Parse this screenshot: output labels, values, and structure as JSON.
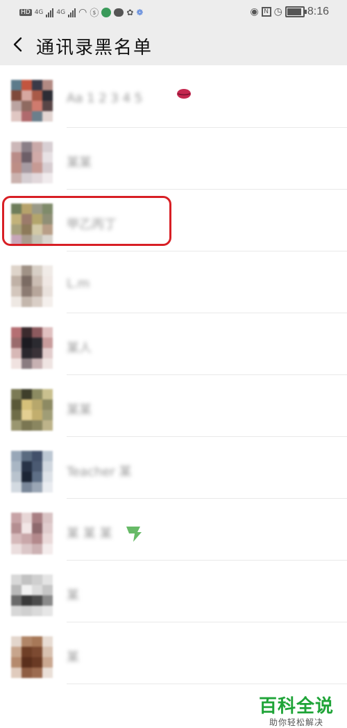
{
  "status_bar": {
    "left_label": "HD",
    "network_1": "4G",
    "network_2": "4G",
    "time": "8:16"
  },
  "header": {
    "title": "通讯录黑名单"
  },
  "contacts": [
    {
      "name": "Aa 1 2 3 4 5",
      "avatar_colors": [
        "#5c7b8b",
        "#c2553f",
        "#3a3a48",
        "#b28a83",
        "#7f4a3b",
        "#d6a7a0",
        "#a95a48",
        "#2d2d35",
        "#bba4a1",
        "#8f6a60",
        "#cf7b6e",
        "#594647",
        "#e0c7c3",
        "#b06a6d",
        "#6b7f8c",
        "#e3d5d2"
      ]
    },
    {
      "name": "某某",
      "avatar_colors": [
        "#ccb7b8",
        "#8a7f87",
        "#c9a9a8",
        "#d8cfd3",
        "#b98c88",
        "#6d5f68",
        "#d0aaa8",
        "#e7e1e4",
        "#bd8e86",
        "#a79ba2",
        "#c69a94",
        "#d7cdd1",
        "#cbb2ae",
        "#d6cfd3",
        "#e2d8db",
        "#f0ebed"
      ]
    },
    {
      "name": "甲乙丙丁",
      "avatar_colors": [
        "#6e7d5a",
        "#b6a26b",
        "#9a9a87",
        "#7f8b6a",
        "#c2b27a",
        "#9b7b6b",
        "#b3a56c",
        "#8f8f76",
        "#a7a17b",
        "#8d7a5a",
        "#d2c9a6",
        "#b89e87",
        "#c7a6b8",
        "#a99b8d",
        "#c2c0b3",
        "#d9d5ce"
      ]
    },
    {
      "name": "L.m",
      "avatar_colors": [
        "#ded4ca",
        "#a09286",
        "#d7cfc6",
        "#f0ebe7",
        "#c0b1a6",
        "#7b6b63",
        "#cbbdb3",
        "#efe7e3",
        "#d3c6bc",
        "#8c7b72",
        "#b7a69b",
        "#e9e1dc",
        "#eee8e3",
        "#c4b7ad",
        "#d9cec6",
        "#f4efec"
      ]
    },
    {
      "name": "某人",
      "avatar_colors": [
        "#b56f73",
        "#3b2a2d",
        "#8c5a5e",
        "#e0c0c0",
        "#9a6b6c",
        "#1c1b21",
        "#2b2a30",
        "#c89c9c",
        "#d7b8b6",
        "#2a272d",
        "#3a3238",
        "#e2cccc",
        "#f0e2e0",
        "#8a7c80",
        "#c7b1b2",
        "#efe4e2"
      ]
    },
    {
      "name": "某某",
      "avatar_colors": [
        "#7b7a55",
        "#3f3f2b",
        "#8c8b62",
        "#c9c08f",
        "#5a5838",
        "#d6c07a",
        "#b7a76c",
        "#8d8a63",
        "#6f6d48",
        "#e3cf92",
        "#c2ae6e",
        "#a09d76",
        "#9a9670",
        "#7a7652",
        "#8a8660",
        "#bdb38a"
      ]
    },
    {
      "name": "Teacher 某",
      "avatar_colors": [
        "#98a7b8",
        "#5a6b80",
        "#42506a",
        "#bcc7d3",
        "#a9b6c4",
        "#283347",
        "#4b5a72",
        "#d0d7df",
        "#b9c3ce",
        "#1c2535",
        "#5e6f86",
        "#dde2e8",
        "#d3dae1",
        "#7a8799",
        "#9aa6b5",
        "#e9ecf0"
      ]
    },
    {
      "name": "某 某 某",
      "avatar_colors": [
        "#c7a3a6",
        "#e7d6d6",
        "#a87f83",
        "#d9c3c4",
        "#b48e91",
        "#f2e6e6",
        "#8e6a6e",
        "#e0cccd",
        "#d5b9ba",
        "#c9a7a9",
        "#b3898c",
        "#ead9d9",
        "#ebdede",
        "#dbc7c8",
        "#cdb2b4",
        "#f4ecec"
      ]
    },
    {
      "name": "某",
      "avatar_colors": [
        "#d8d8d8",
        "#c2c2c2",
        "#cfcfcf",
        "#e4e4e4",
        "#b9b9b9",
        "#f2f2f2",
        "#dcdcdc",
        "#c6c6c6",
        "#6a6a6a",
        "#3a3a3a",
        "#4c4c4c",
        "#8a8a8a",
        "#d7d7d7",
        "#d0d0d0",
        "#dadada",
        "#e6e6e6"
      ]
    },
    {
      "name": "某",
      "avatar_colors": [
        "#e3d6cc",
        "#b08567",
        "#a77858",
        "#e8dcd3",
        "#c7a58c",
        "#6f3f27",
        "#7c4a31",
        "#d8c1b0",
        "#b58a6d",
        "#5b2f1c",
        "#6a3a24",
        "#caa891",
        "#e0cbbd",
        "#8e5d43",
        "#9c6b50",
        "#eadfd7"
      ]
    }
  ],
  "decorations": {
    "lips_color": "#c4284f",
    "leaf_color": "#4cae4c",
    "highlight_color": "#d81f25"
  },
  "watermark": {
    "main": "百科全说",
    "sub": "助你轻松解决"
  }
}
